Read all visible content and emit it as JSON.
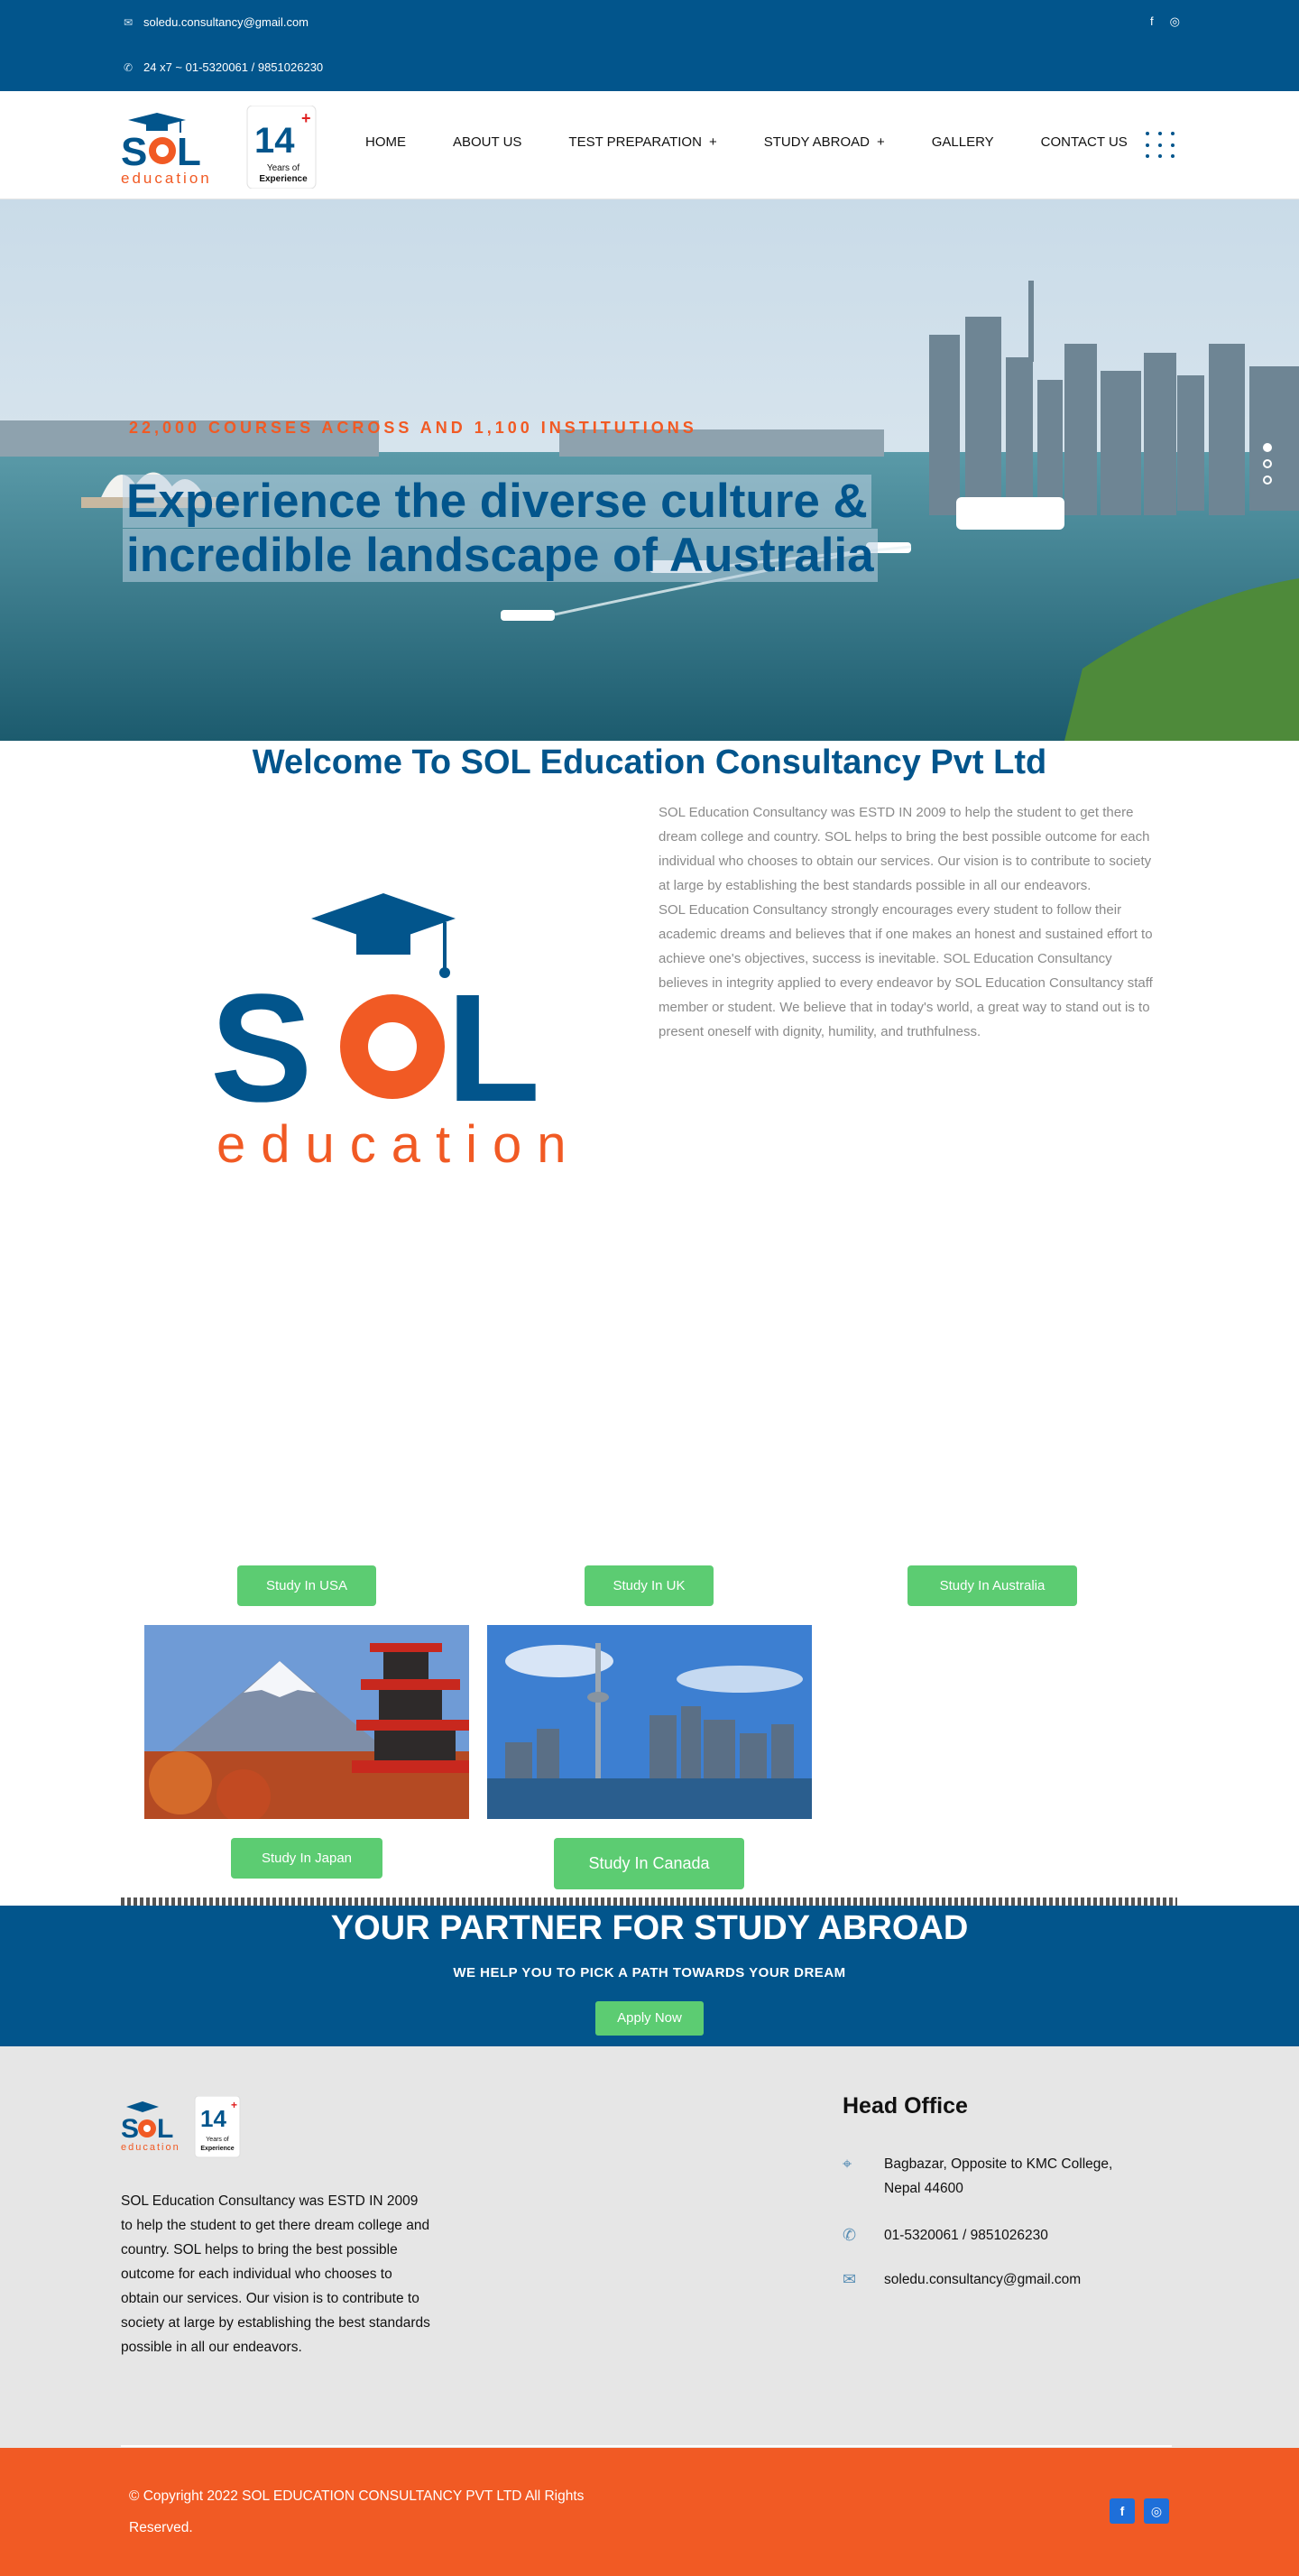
{
  "topbar": {
    "email": "soledu.consultancy@gmail.com",
    "phone": "24 x7 ~ 01-5320061 / 9851026230"
  },
  "logo": {
    "brand_top": "SOL",
    "brand_bottom": "education",
    "years": "14",
    "years_caption_1": "Years of",
    "years_caption_2": "Experience"
  },
  "nav": {
    "home": "HOME",
    "about": "ABOUT US",
    "test_prep": "TEST PREPARATION",
    "study_abroad": "STUDY ABROAD",
    "gallery": "GALLERY",
    "contact": "CONTACT US",
    "plus": "+"
  },
  "hero": {
    "eyebrow": "22,000 COURSES ACROSS AND 1,100 INSTITUTIONS",
    "title_line1": "Experience the diverse culture &",
    "title_line2": "incredible landscape of Australia"
  },
  "welcome": {
    "title": "Welcome To SOL Education Consultancy Pvt Ltd",
    "para1": "SOL Education Consultancy was ESTD IN 2009  to help the student to get there dream college and country. SOL helps to bring the best possible outcome for each individual who chooses to obtain our services. Our vision is to contribute to society at large by establishing the best standards possible in all our endeavors.",
    "para2": "SOL Education Consultancy strongly encourages every student to follow their academic dreams and believes that if one makes an honest and sustained effort to achieve one's objectives, success is inevitable. SOL Education Consultancy believes in integrity applied to every endeavor by SOL Education Consultancy staff member or student. We believe that in today's world, a great way to stand out is to present oneself with dignity, humility, and truthfulness."
  },
  "destinations": {
    "usa": "Study In USA",
    "uk": "Study In UK",
    "australia": "Study In Australia",
    "japan": "Study In Japan",
    "canada": "Study In Canada"
  },
  "partner": {
    "title": "YOUR PARTNER FOR STUDY ABROAD",
    "subtitle": "WE HELP YOU TO PICK A PATH TOWARDS YOUR DREAM",
    "apply": "Apply Now"
  },
  "footer": {
    "about": "SOL Education Consultancy was ESTD IN 2009 to help the student to get there dream college and country. SOL helps to bring the best possible outcome for each individual who chooses to obtain our services. Our vision is to contribute to society at large by establishing the best standards possible in all our endeavors.",
    "head_office": "Head Office",
    "address_1": "Bagbazar, Opposite to KMC College,",
    "address_2": "Nepal 44600",
    "phone": "01-5320061 / 9851026230",
    "email": "soledu.consultancy@gmail.com",
    "copyright": "© Copyright 2022 SOL EDUCATION CONSULTANCY PVT LTD All Rights Reserved."
  },
  "icons": {
    "email": "envelope-icon",
    "phone": "phone-icon",
    "location": "map-pin-icon",
    "facebook": "facebook-icon",
    "instagram": "instagram-icon"
  },
  "colors": {
    "primary_blue": "#02558c",
    "accent_orange": "#f15a24",
    "button_green": "#5ccc72",
    "footer_gray": "#e6e6e6"
  }
}
